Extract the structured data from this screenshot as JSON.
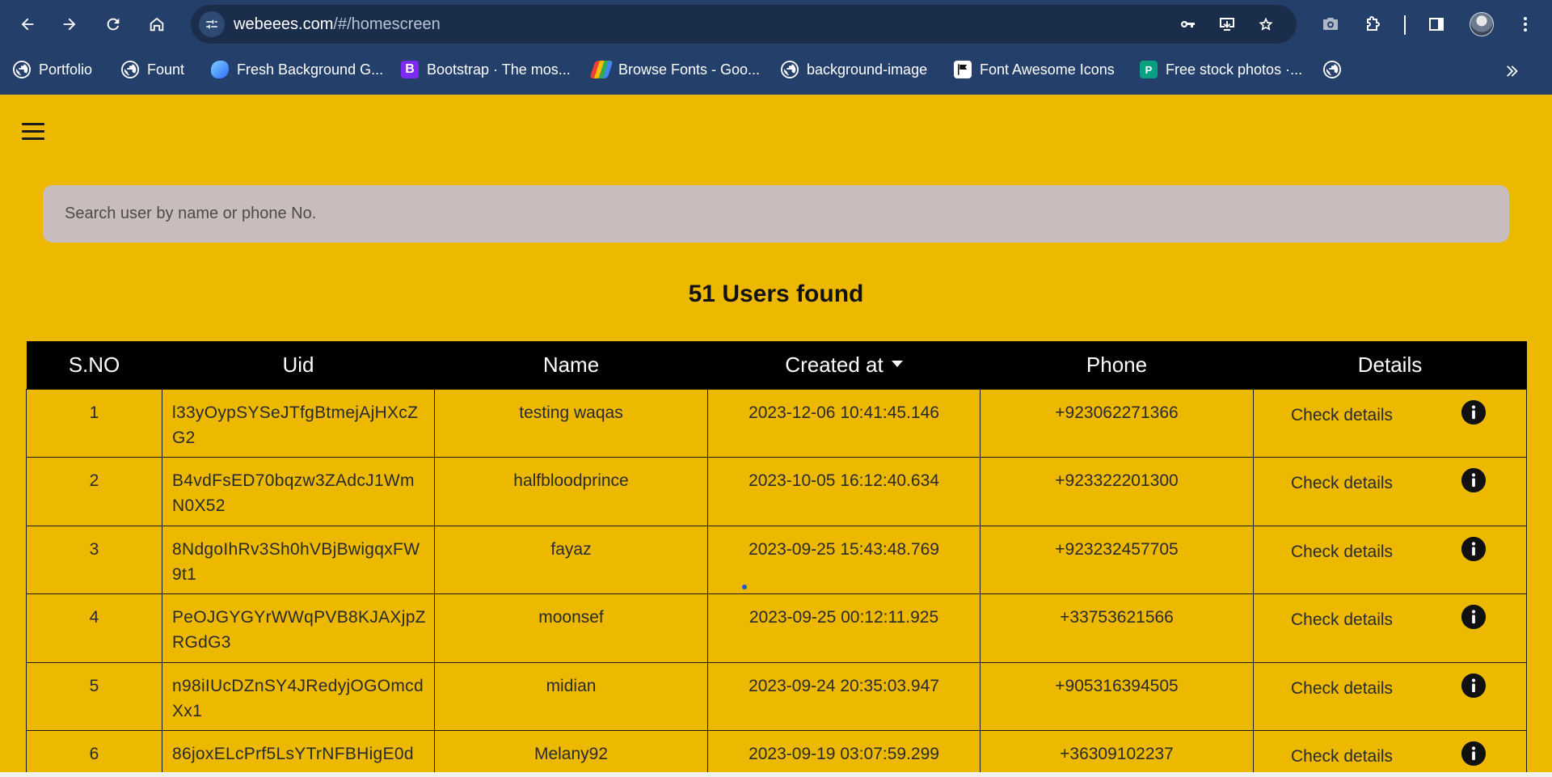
{
  "browser": {
    "url_host": "webeees.com",
    "url_path": "/#/homescreen",
    "bookmarks": [
      {
        "label": "Portfolio",
        "icon": "globe-icon"
      },
      {
        "label": "Fount",
        "icon": "globe-icon"
      },
      {
        "label": "Fresh Background G...",
        "icon": "fresh-background-icon"
      },
      {
        "label": "Bootstrap · The mos...",
        "icon": "bootstrap-icon",
        "glyph": "B"
      },
      {
        "label": "Browse Fonts - Goo...",
        "icon": "google-fonts-icon"
      },
      {
        "label": "background-image",
        "icon": "globe-icon"
      },
      {
        "label": "Font Awesome Icons",
        "icon": "font-awesome-flag-icon"
      },
      {
        "label": "Free stock photos ·...",
        "icon": "pexels-icon",
        "glyph": "P"
      },
      {
        "label": "",
        "icon": "globe-icon"
      }
    ]
  },
  "page": {
    "search_placeholder": "Search user by name or phone No.",
    "users_found": "51 Users found",
    "table": {
      "headers": [
        "S.NO",
        "Uid",
        "Name",
        "Created at",
        "Phone",
        "Details"
      ],
      "sorted_column": "Created at",
      "rows": [
        {
          "sno": "1",
          "uid": "l33yOypSYSeJTfgBtmejAjHXcZG2",
          "name": "testing waqas",
          "created_at": "2023-12-06 10:41:45.146",
          "phone": "+923062271366",
          "details": "Check details"
        },
        {
          "sno": "2",
          "uid": "B4vdFsED70bqzw3ZAdcJ1WmN0X52",
          "name": "halfbloodprince",
          "created_at": "2023-10-05 16:12:40.634",
          "phone": "+923322201300",
          "details": "Check details"
        },
        {
          "sno": "3",
          "uid": "8NdgoIhRv3Sh0hVBjBwigqxFW9t1",
          "name": "fayaz",
          "created_at": "2023-09-25 15:43:48.769",
          "phone": "+923232457705",
          "details": "Check details"
        },
        {
          "sno": "4",
          "uid": "PeOJGYGYrWWqPVB8KJAXjpZRGdG3",
          "name": "moonsef",
          "created_at": "2023-09-25 00:12:11.925",
          "phone": "+33753621566",
          "details": "Check details"
        },
        {
          "sno": "5",
          "uid": "n98iIUcDZnSY4JRedyjOGOmcdXx1",
          "name": "midian",
          "created_at": "2023-09-24 20:35:03.947",
          "phone": "+905316394505",
          "details": "Check details"
        },
        {
          "sno": "6",
          "uid": "86joxELcPrf5LsYTrNFBHigE0d",
          "name": "Melany92",
          "created_at": "2023-09-19 03:07:59.299",
          "phone": "+36309102237",
          "details": "Check details"
        }
      ]
    }
  },
  "colors": {
    "page_background": "#ecb900",
    "chrome_background": "#24406a",
    "table_header_background": "#000000",
    "search_background": "#c8bcbc"
  }
}
